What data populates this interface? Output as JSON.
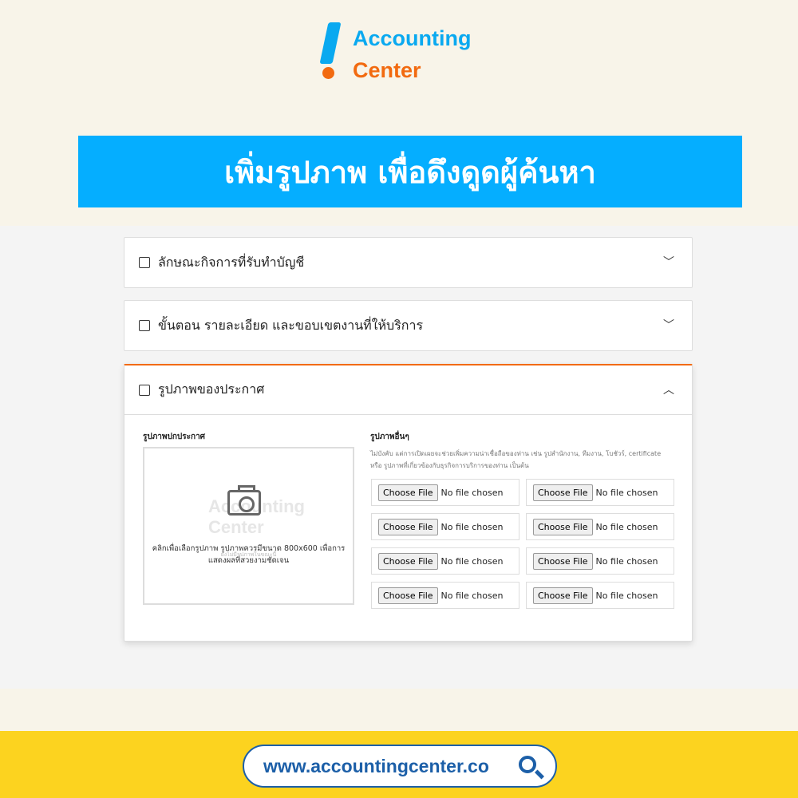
{
  "logo": {
    "line1": "Accounting",
    "line2": "Center"
  },
  "banner": {
    "title": "เพิ่มรูปภาพ  เพื่อดึงดูดผู้ค้นหา"
  },
  "sections": [
    {
      "label": "ลักษณะกิจการที่รับทำบัญชี",
      "icon": "briefcase-icon",
      "expanded": false
    },
    {
      "label": "ขั้นตอน รายละเอียด และขอบเขตงานที่ให้บริการ",
      "icon": "document-icon",
      "expanded": false
    },
    {
      "label": "รูปภาพของประกาศ",
      "icon": "image-icon",
      "expanded": true
    }
  ],
  "cover": {
    "label": "รูปภาพปกประกาศ",
    "instruction": "คลิกเพื่อเลือกรูปภาพ รูปภาพควรมีขนาด 800x600 เพื่อการแสดงผลที่สวยงามชัดเจน",
    "empty": "ยังไม่มีรูปภาพในขณะนี้",
    "watermark": "Accounting Center"
  },
  "others": {
    "label": "รูปภาพอื่นๆ",
    "hint": "ไม่บังคับ แต่การเปิดเผยจะช่วยเพิ่มความน่าเชื่อถือของท่าน เช่น รูปสำนักงาน, ทีมงาน, โบชัวร์, certificate หรือ รูปภาพที่เกี่ยวข้องกับธุรกิจการบริการของท่าน เป็นต้น",
    "button": "Choose File",
    "status": "No file chosen"
  },
  "footer": {
    "url": "www.accountingcenter.co"
  },
  "colors": {
    "accent": "#05aeff",
    "orange": "#f26a10",
    "footer": "#fcd31f"
  }
}
